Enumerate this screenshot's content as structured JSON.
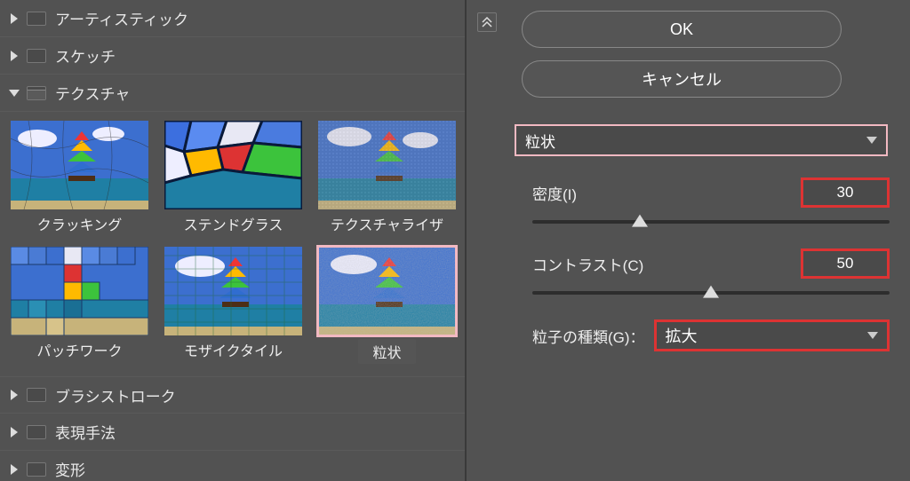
{
  "tree": {
    "artistic": "アーティスティック",
    "sketch": "スケッチ",
    "texture": "テクスチャ",
    "brush": "ブラシストローク",
    "stylize": "表現手法",
    "distort": "変形"
  },
  "thumbs": [
    {
      "label": "クラッキング",
      "key": "craquelure"
    },
    {
      "label": "ステンドグラス",
      "key": "stained"
    },
    {
      "label": "テクスチャライザ",
      "key": "texturizer"
    },
    {
      "label": "パッチワーク",
      "key": "patchwork"
    },
    {
      "label": "モザイクタイル",
      "key": "mosaic"
    },
    {
      "label": "粒状",
      "key": "grain",
      "selected": true
    }
  ],
  "buttons": {
    "ok": "OK",
    "cancel": "キャンセル"
  },
  "filter_name": "粒状",
  "params": {
    "density": {
      "label": "密度(I)",
      "value": "30",
      "pos": 30
    },
    "contrast": {
      "label": "コントラスト(C)",
      "value": "50",
      "pos": 50
    }
  },
  "grain_type": {
    "label": "粒子の種類(G)：",
    "value": "拡大"
  }
}
